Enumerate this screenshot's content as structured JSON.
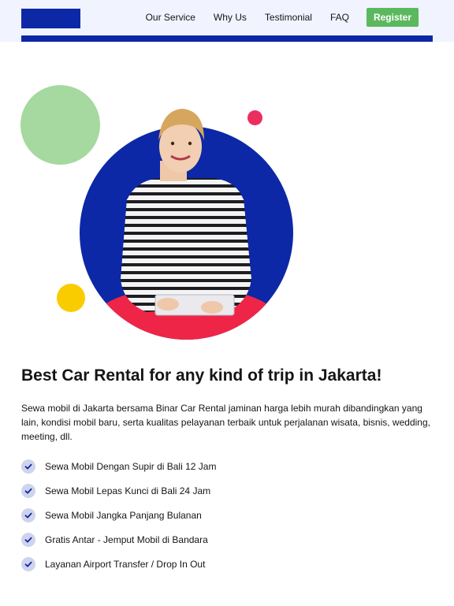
{
  "header": {
    "nav": [
      "Our Service",
      "Why Us",
      "Testimonial",
      "FAQ"
    ],
    "register_label": "Register"
  },
  "hero": {
    "title": "Best Car Rental for any kind of trip in Jakarta!",
    "description": "Sewa mobil di Jakarta bersama Binar Car Rental jaminan harga lebih murah dibandingkan yang lain, kondisi mobil baru, serta kualitas pelayanan terbaik untuk perjalanan wisata, bisnis, wedding, meeting, dll.",
    "features": [
      "Sewa Mobil Dengan Supir di Bali 12 Jam",
      "Sewa Mobil Lepas Kunci di Bali 24 Jam",
      "Sewa Mobil Jangka Panjang Bulanan",
      "Gratis Antar - Jemput Mobil di Bandara",
      "Layanan Airport Transfer / Drop In Out"
    ]
  },
  "colors": {
    "brand_blue": "#0d28a6",
    "register_green": "#5cb85f",
    "accent_green": "#a5d99f",
    "accent_pink": "#ea2f5e",
    "accent_yellow": "#f9cc00"
  },
  "icons": {
    "feature_check": "check-icon"
  }
}
